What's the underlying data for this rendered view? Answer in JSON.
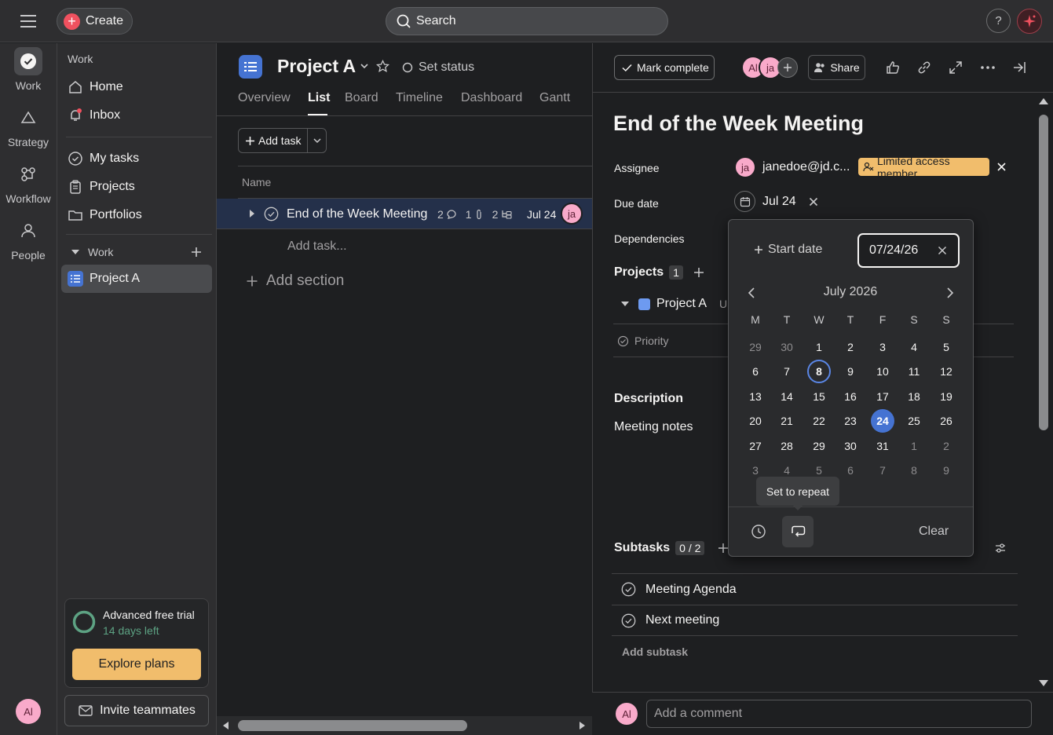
{
  "topbar": {
    "create_label": "Create",
    "search_placeholder": "Search",
    "help_label": "?"
  },
  "rail": {
    "items": [
      {
        "label": "Work",
        "icon": "check-circle-icon"
      },
      {
        "label": "Strategy",
        "icon": "triangle-icon"
      },
      {
        "label": "Workflow",
        "icon": "workflow-icon"
      },
      {
        "label": "People",
        "icon": "people-icon"
      }
    ],
    "avatar": "Al"
  },
  "sidebar": {
    "section_title": "Work",
    "items": [
      {
        "label": "Home",
        "icon": "home-icon"
      },
      {
        "label": "Inbox",
        "icon": "bell-icon"
      },
      {
        "label": "My tasks",
        "icon": "check-circle-icon"
      },
      {
        "label": "Projects",
        "icon": "clipboard-icon"
      },
      {
        "label": "Portfolios",
        "icon": "folder-icon"
      }
    ],
    "work_group": "Work",
    "project": "Project A",
    "trial": {
      "title": "Advanced free trial",
      "days_left": "14 days left",
      "explore_label": "Explore plans"
    },
    "invite_label": "Invite teammates"
  },
  "project": {
    "title": "Project A",
    "set_status": "Set status",
    "tabs": [
      "Overview",
      "List",
      "Board",
      "Timeline",
      "Dashboard",
      "Gantt"
    ],
    "active_tab": "List",
    "add_task_label": "Add task",
    "column_name": "Name",
    "task": {
      "name": "End of the Week Meeting",
      "comments": "2",
      "attachments": "1",
      "subtasks": "2",
      "due": "Jul 24",
      "assignee": "ja"
    },
    "add_task_placeholder": "Add task...",
    "add_section_label": "Add section"
  },
  "detail": {
    "mark_complete": "Mark complete",
    "collaborators": [
      "Al",
      "ja"
    ],
    "share_label": "Share",
    "title": "End of the Week Meeting",
    "assignee_label": "Assignee",
    "assignee_initials": "ja",
    "assignee_email": "janedoe@jd.c...",
    "limited_badge": "Limited access member",
    "due_label": "Due date",
    "due_value": "Jul 24",
    "dependencies_label": "Dependencies",
    "projects_label": "Projects",
    "projects_count": "1",
    "project_name": "Project A",
    "project_section_partial": "Ur",
    "priority_label": "Priority",
    "description_label": "Description",
    "description_text": "Meeting notes",
    "subtasks_label": "Subtasks",
    "subtasks_count": "0 / 2",
    "subtasks": [
      "Meeting Agenda",
      "Next meeting"
    ],
    "add_subtask": "Add subtask",
    "comment_avatar": "Al",
    "comment_placeholder": "Add a comment"
  },
  "picker": {
    "start_date_label": "Start date",
    "date_value": "07/24/26",
    "month": "July 2026",
    "weekdays": [
      "M",
      "T",
      "W",
      "T",
      "F",
      "S",
      "S"
    ],
    "weeks": [
      [
        "29",
        "30",
        "1",
        "2",
        "3",
        "4",
        "5"
      ],
      [
        "6",
        "7",
        "8",
        "9",
        "10",
        "11",
        "12"
      ],
      [
        "13",
        "14",
        "15",
        "16",
        "17",
        "18",
        "19"
      ],
      [
        "20",
        "21",
        "22",
        "23",
        "24",
        "25",
        "26"
      ],
      [
        "27",
        "28",
        "29",
        "30",
        "31",
        "1",
        "2"
      ],
      [
        "3",
        "4",
        "5",
        "6",
        "7",
        "8",
        "9"
      ]
    ],
    "today": "8",
    "selected": "24",
    "tooltip": "Set to repeat",
    "clear_label": "Clear"
  },
  "colors": {
    "accent_blue": "#4573d2",
    "brand_coral": "#f0515f",
    "badge_yellow": "#f1bd6c",
    "avatar_pink": "#f9aaca"
  }
}
